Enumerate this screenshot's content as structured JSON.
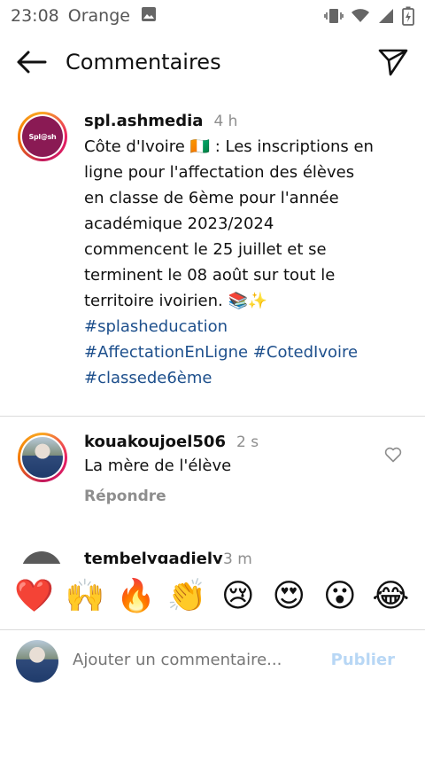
{
  "status_bar": {
    "time": "23:08",
    "carrier": "Orange",
    "icons": [
      "gallery-icon",
      "vibrate-icon",
      "wifi-icon",
      "signal-icon",
      "battery-charging-icon"
    ]
  },
  "header": {
    "title": "Commentaires",
    "back_icon": "arrow-left-icon",
    "share_icon": "paper-plane-icon"
  },
  "caption": {
    "username": "spl.ashmedia",
    "time_ago": "4 h",
    "avatar_text": "Spl@sh",
    "text": "Côte d'Ivoire 🇨🇮 : Les inscriptions en ligne pour l'affectation des élèves en classe de 6ème pour l'année académique 2023/2024 commencent le 25 juillet et se terminent le 08 août sur tout le territoire ivoirien. 📚✨",
    "hashtags": [
      "#splasheducation",
      "#AffectationEnLigne",
      "#CotedIvoire",
      "#classede6ème"
    ]
  },
  "comments": [
    {
      "username": "kouakoujoel506",
      "time_ago": "2 s",
      "text": "La mère de l'élève",
      "reply_label": "Répondre"
    }
  ],
  "partial_comment": {
    "username": "tembelygadiely",
    "time_ago": "3 m"
  },
  "emoji_bar": [
    "❤️",
    "🙌",
    "🔥",
    "👏",
    "😢",
    "😍",
    "😮",
    "😂"
  ],
  "composer": {
    "placeholder": "Ajouter un commentaire...",
    "post_label": "Publier"
  },
  "colors": {
    "hashtag": "#1d4f8c",
    "secondary_text": "#8e8e8e",
    "post_disabled": "#b8d7f5",
    "brand_avatar": "#8a1a54"
  }
}
